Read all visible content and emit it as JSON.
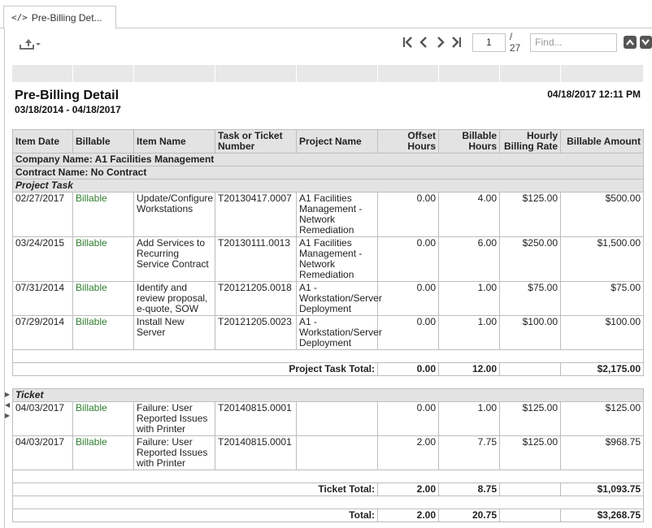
{
  "tab": {
    "code_glyph": "</>",
    "label": "Pre-Billing Det..."
  },
  "toolbar": {
    "page_value": "1",
    "page_count": "/ 27",
    "find_placeholder": "Find..."
  },
  "report": {
    "title": "Pre-Billing Detail",
    "date_range": "03/18/2014 - 04/18/2017",
    "run_time": "04/18/2017 12:11 PM",
    "columns": [
      "Item Date",
      "Billable",
      "Item Name",
      "Task or Ticket Number",
      "Project Name",
      "Offset Hours",
      "Billable Hours",
      "Hourly Billing Rate",
      "Billable Amount"
    ],
    "company": "Company Name: A1 Facilities Management",
    "contract": "Contract Name: No Contract",
    "groups": [
      {
        "name": "Project Task",
        "rows": [
          {
            "date": "02/27/2017",
            "billable": "Billable",
            "item": "Update/Configure Workstations",
            "number": "T20130417.0007",
            "project": "A1 Facilities Management - Network Remediation",
            "offset": "0.00",
            "hours": "4.00",
            "rate": "$125.00",
            "amount": "$500.00"
          },
          {
            "date": "03/24/2015",
            "billable": "Billable",
            "item": "Add Services to Recurring Service  Contract",
            "number": "T20130111.0013",
            "project": "A1 Facilities Management - Network Remediation",
            "offset": "0.00",
            "hours": "6.00",
            "rate": "$250.00",
            "amount": "$1,500.00"
          },
          {
            "date": "07/31/2014",
            "billable": "Billable",
            "item": "Identify and review proposal, e-quote, SOW",
            "number": "T20121205.0018",
            "project": "A1 - Workstation/Server Deployment",
            "offset": "0.00",
            "hours": "1.00",
            "rate": "$75.00",
            "amount": "$75.00"
          },
          {
            "date": "07/29/2014",
            "billable": "Billable",
            "item": "Install New Server",
            "number": "T20121205.0023",
            "project": "A1 - Workstation/Server Deployment",
            "offset": "0.00",
            "hours": "1.00",
            "rate": "$100.00",
            "amount": "$100.00"
          }
        ],
        "total_label": "Project Task Total:",
        "total_offset": "0.00",
        "total_hours": "12.00",
        "total_amount": "$2,175.00"
      },
      {
        "name": "Ticket",
        "rows": [
          {
            "date": "04/03/2017",
            "billable": "Billable",
            "item": "Failure:  User Reported Issues with Printer",
            "number": "T20140815.0001",
            "project": "",
            "offset": "0.00",
            "hours": "1.00",
            "rate": "$125.00",
            "amount": "$125.00"
          },
          {
            "date": "04/03/2017",
            "billable": "Billable",
            "item": "Failure:  User Reported Issues with Printer",
            "number": "T20140815.0001",
            "project": "",
            "offset": "2.00",
            "hours": "7.75",
            "rate": "$125.00",
            "amount": "$968.75"
          }
        ],
        "total_label": "Ticket Total:",
        "total_offset": "2.00",
        "total_hours": "8.75",
        "total_amount": "$1,093.75"
      }
    ],
    "grand_total_label": "Total:",
    "grand_total_offset": "2.00",
    "grand_total_hours": "20.75",
    "grand_total_amount": "$3,268.75"
  }
}
